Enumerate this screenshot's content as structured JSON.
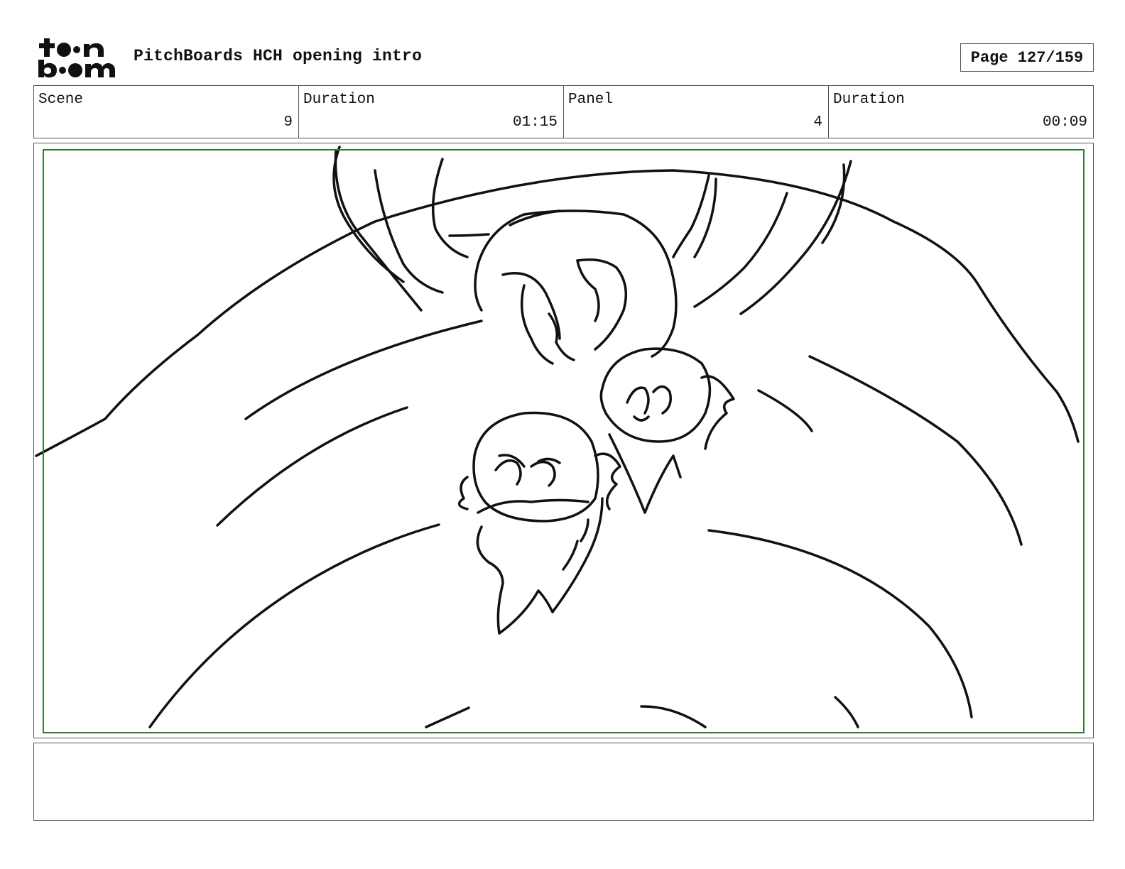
{
  "header": {
    "logo_text": "toon boom",
    "title": "PitchBoards HCH opening intro",
    "page_label": "Page 127/159"
  },
  "info": {
    "scene_label": "Scene",
    "scene_value": "9",
    "scene_duration_label": "Duration",
    "scene_duration_value": "01:15",
    "panel_label": "Panel",
    "panel_value": "4",
    "panel_duration_label": "Duration",
    "panel_duration_value": "00:09"
  },
  "notes": {
    "text": ""
  },
  "colors": {
    "safe_area": "#2f7d32",
    "ink": "#111111"
  }
}
